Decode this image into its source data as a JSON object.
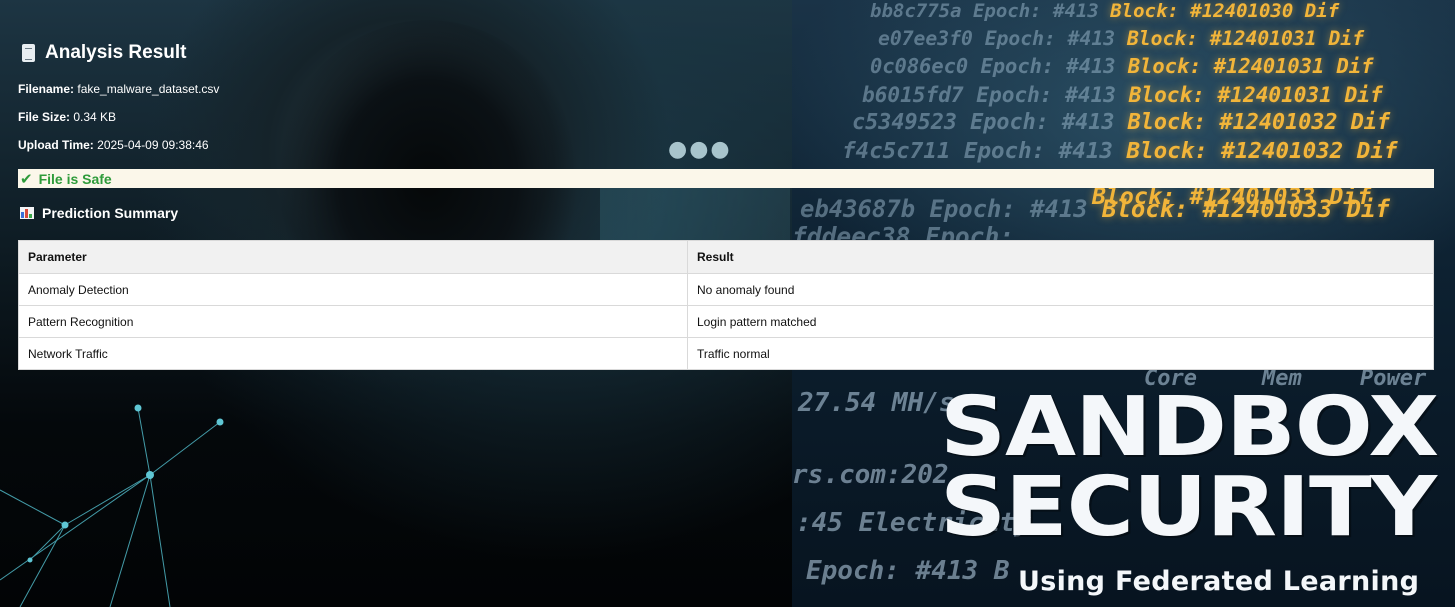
{
  "page": {
    "title": "Analysis Result",
    "title_icon": "document-icon"
  },
  "file": {
    "filename_label": "Filename:",
    "filename": "fake_malware_dataset.csv",
    "size_label": "File Size:",
    "size": "0.34 KB",
    "upload_label": "Upload Time:",
    "upload_time": "2025-04-09 09:38:46"
  },
  "status": {
    "icon": "check-icon",
    "text": "File is Safe",
    "color": "#2e9b3a",
    "background": "#fbf7ea"
  },
  "summary": {
    "title": "Prediction Summary",
    "icon": "bar-chart-icon",
    "headers": [
      "Parameter",
      "Result"
    ],
    "rows": [
      [
        "Anomaly Detection",
        "No anomaly found"
      ],
      [
        "Pattern Recognition",
        "Login pattern matched"
      ],
      [
        "Network Traffic",
        "Traffic normal"
      ]
    ]
  },
  "background": {
    "code_lines": [
      {
        "hash": "bb8c775a",
        "epoch": "Epoch: #413",
        "block": "Block: #12401030",
        "tail": "Dif"
      },
      {
        "hash": "e07ee3f0",
        "epoch": "Epoch: #413",
        "block": "Block: #12401031",
        "tail": "Dif"
      },
      {
        "hash": "0c086ec0",
        "epoch": "Epoch: #413",
        "block": "Block: #12401031",
        "tail": "Dif"
      },
      {
        "hash": "b6015fd7",
        "epoch": "Epoch: #413",
        "block": "Block: #12401031",
        "tail": "Dif"
      },
      {
        "hash": "c5349523",
        "epoch": "Epoch: #413",
        "block": "Block: #12401032",
        "tail": "Dif"
      },
      {
        "hash": "f4c5c711",
        "epoch": "Epoch: #413",
        "block": "Block: #12401032",
        "tail": "Dif"
      },
      {
        "hash": "",
        "epoch": "",
        "block": "Block: #12401033",
        "tail": "Dif"
      },
      {
        "hash": "eb43687b",
        "epoch": "Epoch: #413",
        "block": "Block: #12401033",
        "tail": "Dif"
      },
      {
        "hash": "fddeec38",
        "epoch": "Epoch:",
        "block": "",
        "tail": ""
      }
    ],
    "lower_code": [
      "27.54 MH/s",
      "rs.com:202",
      ":45 Electricity",
      "Epoch: #413 B"
    ],
    "lower_right": [
      "Core",
      "Mem",
      "Power"
    ]
  },
  "brand": {
    "line1": "SANDBOX",
    "line2": "SECURITY",
    "subtitle": "Using Federated Learning"
  }
}
